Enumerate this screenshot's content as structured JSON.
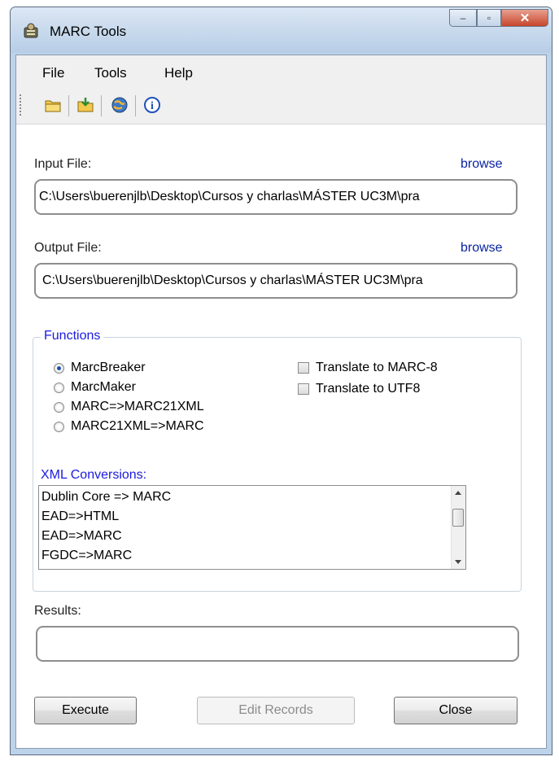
{
  "window": {
    "title": "MARC Tools",
    "icon": "marc-tools-app-icon"
  },
  "title_buttons": {
    "minimize": "–",
    "maximize": "▫",
    "close": "✕"
  },
  "menu": {
    "items": [
      "File",
      "Tools",
      "Help"
    ]
  },
  "toolbar": {
    "icons": [
      "open-folder-icon",
      "export-folder-icon",
      "globe-icon",
      "info-icon"
    ],
    "info_glyph": "i"
  },
  "input_file": {
    "label": "Input File:",
    "browse": "browse",
    "value": "C:\\Users\\buerenjlb\\Desktop\\Cursos y charlas\\MÁSTER UC3M\\pra"
  },
  "output_file": {
    "label": "Output File:",
    "browse": "browse",
    "value": "C:\\Users\\buerenjlb\\Desktop\\Cursos y charlas\\MÁSTER UC3M\\pra"
  },
  "functions": {
    "title": "Functions",
    "radios": [
      {
        "label": "MarcBreaker",
        "selected": true
      },
      {
        "label": "MarcMaker",
        "selected": false
      },
      {
        "label": "MARC=>MARC21XML",
        "selected": false
      },
      {
        "label": "MARC21XML=>MARC",
        "selected": false
      }
    ],
    "checkboxes": [
      {
        "label": "Translate to MARC-8",
        "checked": false
      },
      {
        "label": "Translate to UTF8",
        "checked": false
      }
    ],
    "xml_label": "XML Conversions:",
    "xml_items": [
      "Dublin Core => MARC",
      "EAD=>HTML",
      "EAD=>MARC",
      "FGDC=>MARC"
    ]
  },
  "results": {
    "label": "Results:",
    "value": ""
  },
  "buttons": {
    "execute": "Execute",
    "edit_records": "Edit Records",
    "close": "Close"
  },
  "colors": {
    "link": "#0a24a0",
    "group_title": "#1a1ae0",
    "window_frame": "#bcd3ea"
  }
}
